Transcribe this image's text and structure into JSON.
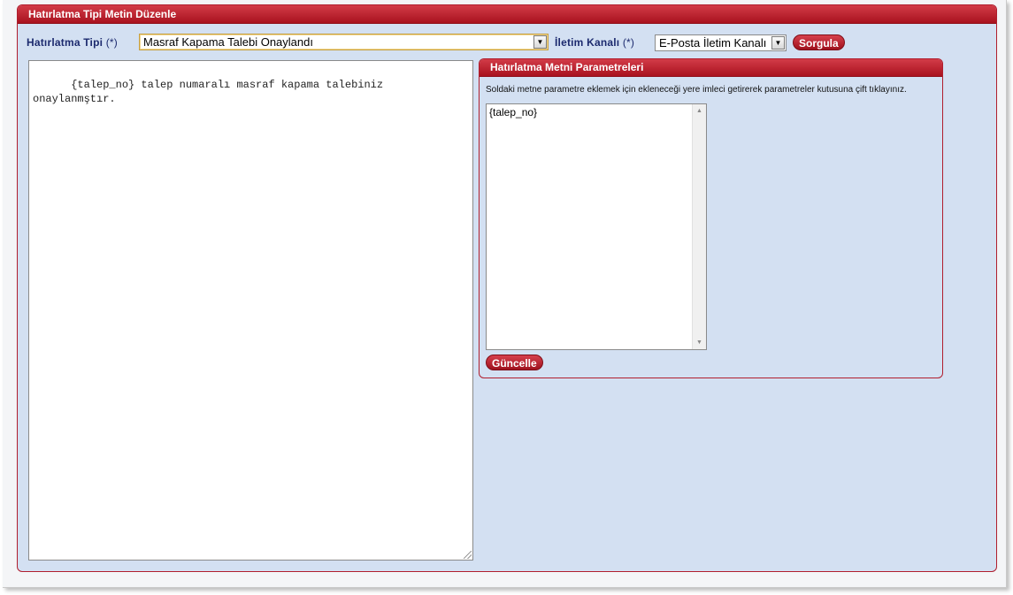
{
  "panel": {
    "title": "Hatırlatma Tipi Metin Düzenle"
  },
  "filters": {
    "type_label": "Hatırlatma Tipi",
    "type_required": "(*)",
    "type_value": "Masraf Kapama Talebi Onaylandı",
    "channel_label": "İletim Kanalı",
    "channel_required": "(*)",
    "channel_value": "E-Posta İletim Kanalı",
    "query_button": "Sorgula"
  },
  "editor": {
    "text": "{talep_no} talep numaralı masraf kapama talebiniz\nonaylanmştır."
  },
  "params_panel": {
    "title": "Hatırlatma Metni Parametreleri",
    "hint": "Soldaki metne parametre eklemek için ekleneceği yere imleci getirerek parametreler kutusuna çift tıklayınız.",
    "items": [
      "{talep_no}"
    ],
    "update_button": "Güncelle"
  },
  "icons": {
    "dropdown": "chevron-down-icon",
    "scroll_up": "scroll-up-icon",
    "scroll_down": "scroll-down-icon",
    "resize": "resize-grip-icon"
  },
  "colors": {
    "accent_red": "#b01e2e",
    "panel_bg": "#d3e0f2",
    "label_blue": "#1c2a6e"
  }
}
